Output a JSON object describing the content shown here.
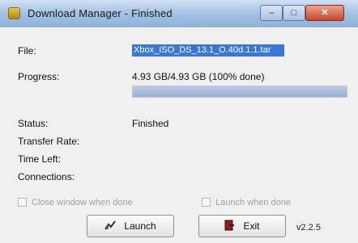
{
  "window": {
    "title": "Download Manager - Finished",
    "min_glyph": "–",
    "max_glyph": "□",
    "close_glyph": "✕"
  },
  "fields": {
    "file_label": "File:",
    "file_value": "Xbox_ISO_DS_13.1_O.40d.1.1.tar",
    "progress_label": "Progress:",
    "progress_text": "4.93 GB/4.93 GB (100% done)",
    "progress_fraction": 1.0,
    "status_label": "Status:",
    "status_value": "Finished",
    "transfer_rate_label": "Transfer Rate:",
    "time_left_label": "Time Left:",
    "connections_label": "Connections:"
  },
  "options": {
    "close_when_done": "Close window when done",
    "launch_when_done": "Launch when done"
  },
  "buttons": {
    "launch": "Launch",
    "exit": "Exit"
  },
  "version": "v2.2.5",
  "icons": {
    "app": "download-manager-icon",
    "launch": "launch-icon",
    "exit": "exit-icon"
  },
  "colors": {
    "selection": "#3a77d6",
    "progress_fill": "#98b2d6",
    "close_button": "#c9452b"
  }
}
